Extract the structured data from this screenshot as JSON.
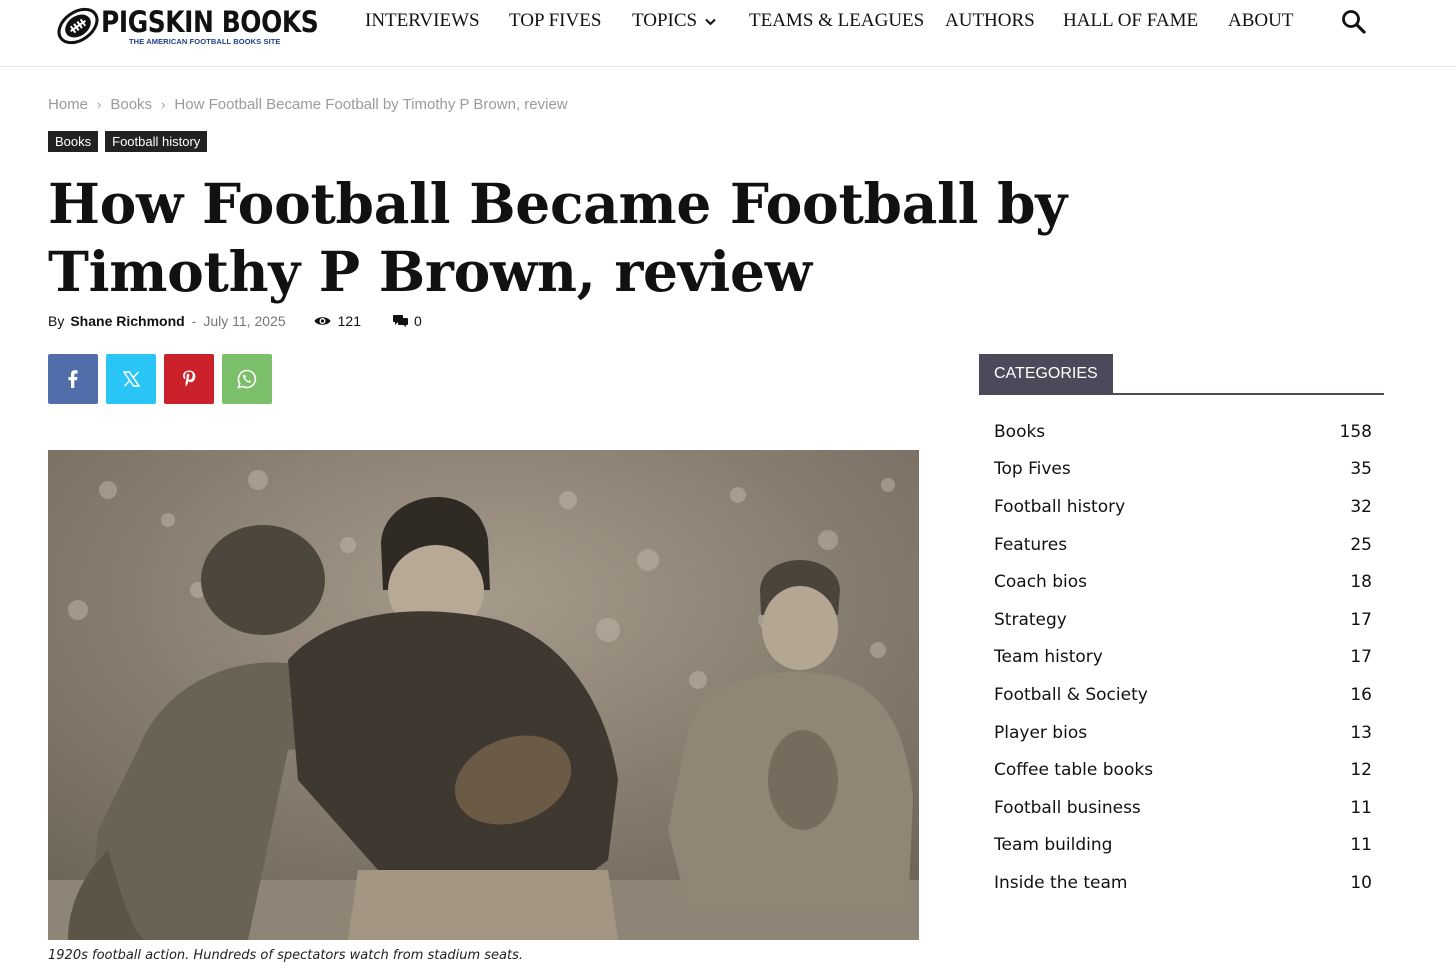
{
  "site": {
    "name": "PIGSKIN BOOKS",
    "tagline": "THE AMERICAN FOOTBALL BOOKS SITE"
  },
  "nav": {
    "items": [
      {
        "label": "INTERVIEWS"
      },
      {
        "label": "TOP FIVES"
      },
      {
        "label": "TOPICS",
        "has_dropdown": true
      },
      {
        "label": "TEAMS & LEAGUES"
      },
      {
        "label": "AUTHORS"
      },
      {
        "label": "HALL OF FAME"
      },
      {
        "label": "ABOUT"
      }
    ],
    "search_icon": "search-icon"
  },
  "breadcrumb": [
    "Home",
    "Books",
    "How Football Became Football by Timothy P Brown, review"
  ],
  "tags": [
    "Books",
    "Football history"
  ],
  "article": {
    "title": "How Football Became Football by Timothy P Brown, review",
    "by_label": "By",
    "author": "Shane Richmond",
    "separator": "-",
    "date": "July 11, 2025",
    "views": "121",
    "comments": "0",
    "caption": "1920s football action. Hundreds of spectators watch from stadium seats."
  },
  "share": [
    {
      "network": "facebook",
      "icon": "facebook-icon",
      "color": "#516eab"
    },
    {
      "network": "x",
      "icon": "x-icon",
      "color": "#29c5f6"
    },
    {
      "network": "pinterest",
      "icon": "pinterest-icon",
      "color": "#ca212a"
    },
    {
      "network": "whatsapp",
      "icon": "whatsapp-icon",
      "color": "#7bbf6a"
    }
  ],
  "sidebar": {
    "widget_title": "CATEGORIES",
    "categories": [
      {
        "name": "Books",
        "count": "158"
      },
      {
        "name": "Top Fives",
        "count": "35"
      },
      {
        "name": "Football history",
        "count": "32"
      },
      {
        "name": "Features",
        "count": "25"
      },
      {
        "name": "Coach bios",
        "count": "18"
      },
      {
        "name": "Strategy",
        "count": "17"
      },
      {
        "name": "Team history",
        "count": "17"
      },
      {
        "name": "Football & Society",
        "count": "16"
      },
      {
        "name": "Player bios",
        "count": "13"
      },
      {
        "name": "Coffee table books",
        "count": "12"
      },
      {
        "name": "Football business",
        "count": "11"
      },
      {
        "name": "Team building",
        "count": "11"
      },
      {
        "name": "Inside the team",
        "count": "10"
      }
    ]
  },
  "colors": {
    "tag_bg": "#222222",
    "widget_head_bg": "#4a4a5a",
    "logo_tagline": "#1f3f8a",
    "breadcrumb_text": "#9b9b9b"
  }
}
